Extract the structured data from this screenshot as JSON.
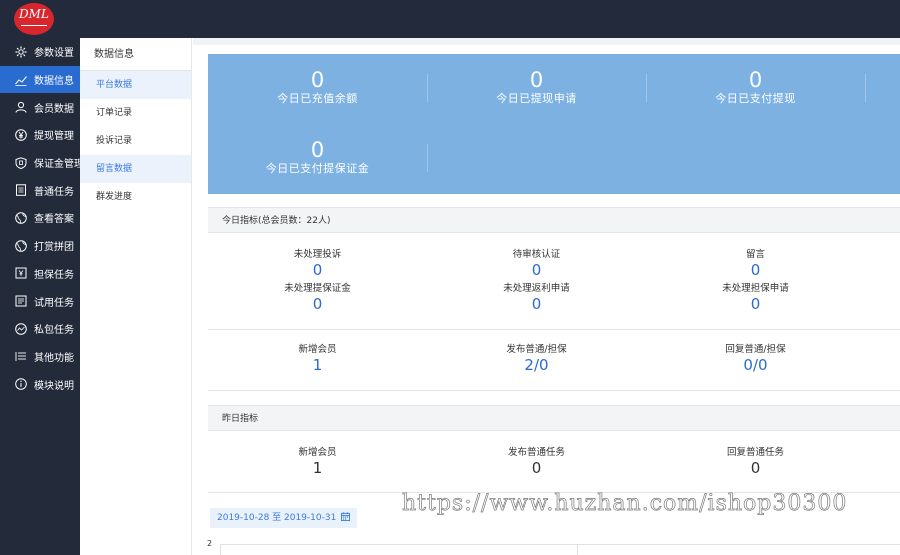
{
  "brand": {
    "logo_text": "DML"
  },
  "sidebar": {
    "items": [
      {
        "label": "参数设置",
        "icon": "gear-icon"
      },
      {
        "label": "数据信息",
        "icon": "chart-icon",
        "active": true
      },
      {
        "label": "会员数据",
        "icon": "user-icon"
      },
      {
        "label": "提现管理",
        "icon": "yen-icon"
      },
      {
        "label": "保证金管理",
        "icon": "shield-icon"
      },
      {
        "label": "普通任务",
        "icon": "doc-icon"
      },
      {
        "label": "查看答案",
        "icon": "globe-icon"
      },
      {
        "label": "打赏拼团",
        "icon": "globe-icon"
      },
      {
        "label": "担保任务",
        "icon": "guarantee-icon"
      },
      {
        "label": "试用任务",
        "icon": "list-icon"
      },
      {
        "label": "私包任务",
        "icon": "circle-chart-icon"
      },
      {
        "label": "其他功能",
        "icon": "menu-icon"
      },
      {
        "label": "模块说明",
        "icon": "info-icon"
      }
    ]
  },
  "subnav": {
    "title": "数据信息",
    "items": [
      {
        "label": "平台数据",
        "active": true
      },
      {
        "label": "订单记录"
      },
      {
        "label": "投诉记录"
      },
      {
        "label": "留言数据",
        "active": true
      },
      {
        "label": "群发进度"
      }
    ]
  },
  "stats": [
    {
      "value": "0",
      "label": "今日已充值余额"
    },
    {
      "value": "0",
      "label": "今日已提现申请"
    },
    {
      "value": "0",
      "label": "今日已支付提现"
    },
    {
      "value": "0",
      "label": "今日已支付提保证金"
    }
  ],
  "today": {
    "header": "今日指标(总会员数：22人)",
    "row1": [
      {
        "label": "未处理投诉",
        "value": "0"
      },
      {
        "label": "待审核认证",
        "value": "0"
      },
      {
        "label": "留言",
        "value": "0"
      }
    ],
    "row2": [
      {
        "label": "未处理提保证金",
        "value": "0"
      },
      {
        "label": "未处理返利申请",
        "value": "0"
      },
      {
        "label": "未处理担保申请",
        "value": "0"
      }
    ],
    "row3": [
      {
        "label": "新增会员",
        "value": "1"
      },
      {
        "label": "发布普通/担保",
        "value": "2/0"
      },
      {
        "label": "回复普通/担保",
        "value": "0/0"
      }
    ]
  },
  "yesterday": {
    "header": "昨日指标",
    "row": [
      {
        "label": "新增会员",
        "value": "1"
      },
      {
        "label": "发布普通任务",
        "value": "0"
      },
      {
        "label": "回复普通任务",
        "value": "0"
      }
    ]
  },
  "date_range": {
    "label": "2019-10-28 至 2019-10-31",
    "icon": "calendar-icon"
  },
  "chart": {
    "y_tick": "2"
  },
  "watermark": "https://www.huzhan.com/ishop30300",
  "colors": {
    "sidebar_bg": "#232a3a",
    "active_blue": "#2a6bd0",
    "stats_bg": "#7cb1e2",
    "logo_red": "#d8262f"
  }
}
